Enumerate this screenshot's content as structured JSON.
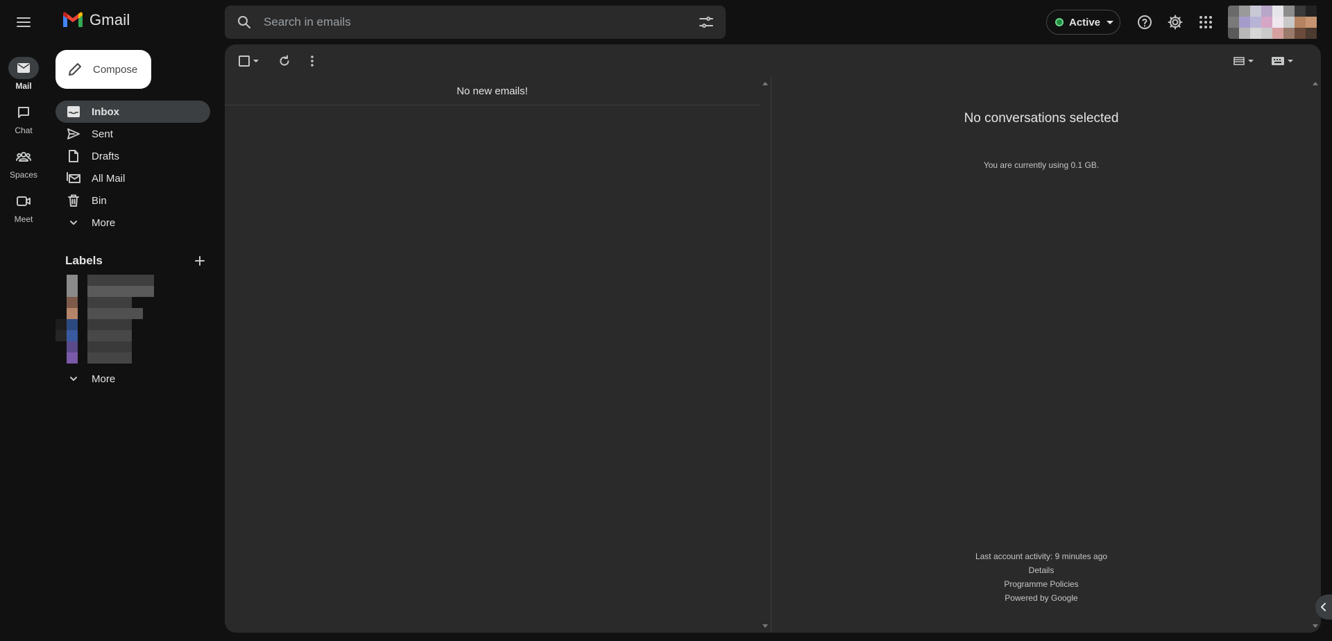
{
  "app": {
    "name": "Gmail"
  },
  "search": {
    "placeholder": "Search in emails"
  },
  "status": {
    "label": "Active",
    "color": "#1e8e3e"
  },
  "header_icons": [
    "menu-icon",
    "search-icon",
    "tune-icon",
    "help-icon",
    "gear-icon",
    "apps-icon"
  ],
  "rail": {
    "items": [
      {
        "label": "Mail",
        "icon": "mail-icon",
        "active": true
      },
      {
        "label": "Chat",
        "icon": "chat-icon",
        "active": false
      },
      {
        "label": "Spaces",
        "icon": "spaces-icon",
        "active": false
      },
      {
        "label": "Meet",
        "icon": "meet-icon",
        "active": false
      }
    ]
  },
  "compose": {
    "label": "Compose"
  },
  "nav": {
    "items": [
      {
        "label": "Inbox",
        "icon": "inbox-icon",
        "active": true
      },
      {
        "label": "Sent",
        "icon": "send-icon"
      },
      {
        "label": "Drafts",
        "icon": "draft-icon"
      },
      {
        "label": "All Mail",
        "icon": "all-mail-icon"
      },
      {
        "label": "Bin",
        "icon": "bin-icon"
      },
      {
        "label": "More",
        "icon": "chevron-down-icon"
      }
    ]
  },
  "labels": {
    "title": "Labels",
    "more_label": "More",
    "chip_colors": [
      "#8a8a8a",
      "#8a8a8a",
      "#7d5a4a",
      "#b5856a",
      "#2c4a80",
      "#3a5aa0",
      "#5a4a8a",
      "#7a5aa8"
    ]
  },
  "list": {
    "empty_message": "No new emails!"
  },
  "reading_pane": {
    "title": "No conversations selected",
    "usage": "You are currently using 0.1 GB.",
    "last_activity": "Last account activity: 9 minutes ago",
    "details": "Details",
    "policies": "Programme Policies",
    "powered": "Powered by Google"
  }
}
